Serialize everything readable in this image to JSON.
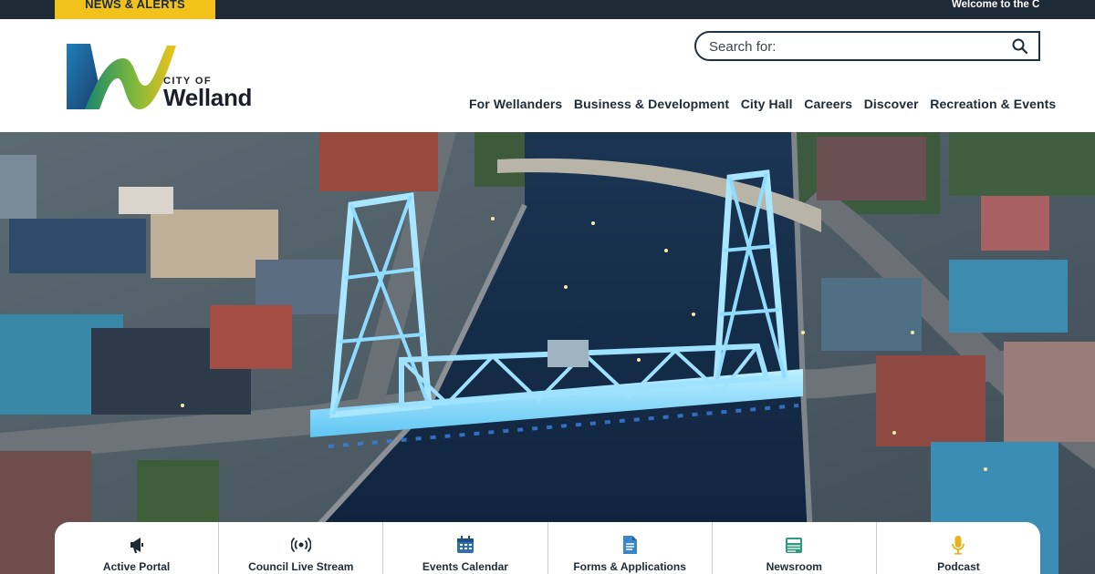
{
  "topbar": {
    "alerts_label": "NEWS & ALERTS",
    "welcome_text": "Welcome to the Ci"
  },
  "logo": {
    "small_text": "CITY OF",
    "big_text": "Welland"
  },
  "search": {
    "placeholder": "Search for:",
    "value": ""
  },
  "nav": [
    {
      "label": "For Wellanders"
    },
    {
      "label": "Business & Development"
    },
    {
      "label": "City Hall"
    },
    {
      "label": "Careers"
    },
    {
      "label": "Discover"
    },
    {
      "label": "Recreation & Events"
    }
  ],
  "quick_links": [
    {
      "label": "Active Portal",
      "icon": "megaphone-icon"
    },
    {
      "label": "Council Live Stream",
      "icon": "broadcast-icon"
    },
    {
      "label": "Events Calendar",
      "icon": "calendar-icon"
    },
    {
      "label": "Forms & Applications",
      "icon": "document-icon"
    },
    {
      "label": "Newsroom",
      "icon": "newspaper-icon"
    },
    {
      "label": "Podcast",
      "icon": "microphone-icon"
    }
  ],
  "colors": {
    "alert_yellow": "#f2c21b",
    "topbar_dark": "#1e2a35",
    "navy": "#1e3244",
    "bridge_glow": "#7fd8ff",
    "icon_blue": "#3a86c8",
    "icon_teal": "#2f9a7c",
    "icon_gold": "#e8b31e"
  }
}
